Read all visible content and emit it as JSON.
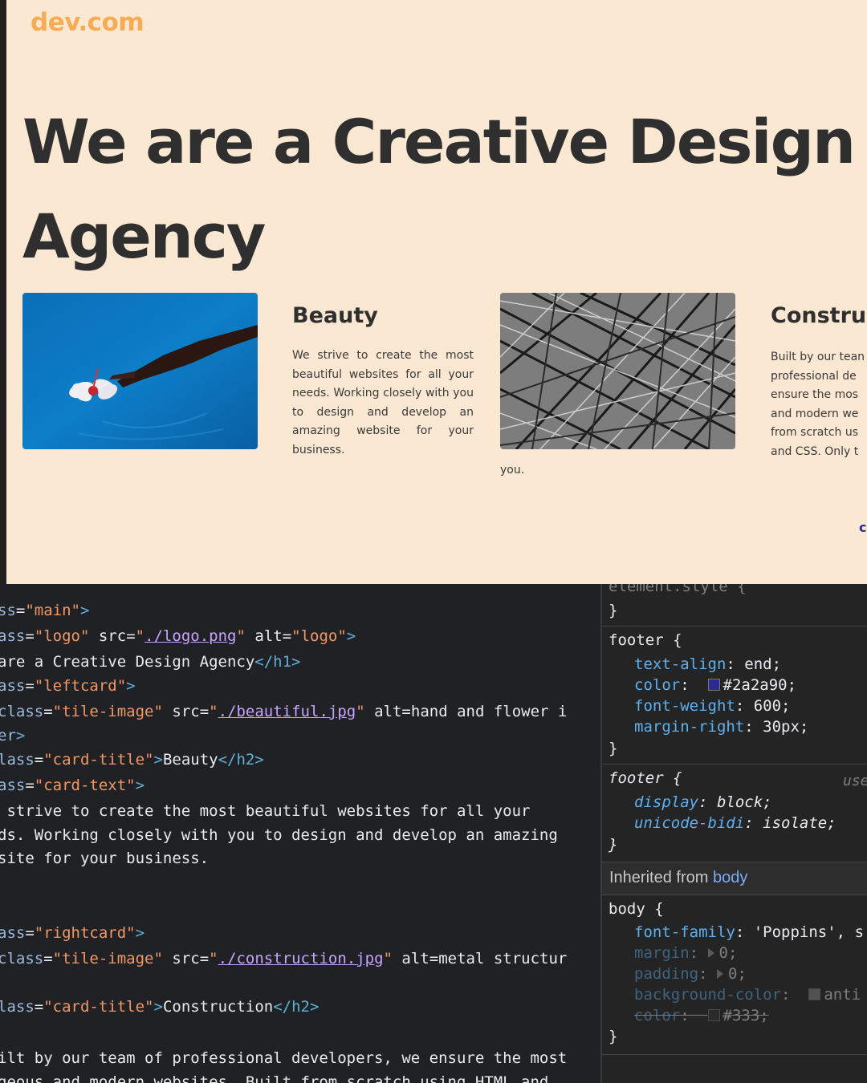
{
  "site": {
    "logo": "dev.com",
    "heading_line1": "We are a Creative Design",
    "heading_line2": "Agency",
    "cards": [
      {
        "title": "Beauty",
        "text": "We strive to create the most beautiful websites for all your needs. Working closely with you to design and develop an amazing website for your business."
      },
      {
        "title": "Constru",
        "text_lines": [
          "Built by our tean",
          "professional de",
          "ensure the mos",
          "and modern we",
          "from scratch us",
          "and CSS. Only t"
        ],
        "stray_text": "you."
      }
    ],
    "footer_fragment": "c"
  },
  "elements": {
    "lines": [
      [
        "ss=\"main\">"
      ],
      [
        "ass=\"logo\" src=\"./logo.png\" alt=\"logo\">"
      ],
      [
        "are a Creative Design Agency</h1>"
      ],
      [
        "ass=\"leftcard\">"
      ],
      [
        "class=\"tile-image\" src=\"./beautiful.jpg\" alt=\"hand and flower i"
      ],
      [
        "er\">"
      ],
      [
        "lass=\"card-title\">Beauty</h2>"
      ],
      [
        "ass=\"card-text\">"
      ],
      [
        " strive to create the most beautiful websites for all your"
      ],
      [
        "ds. Working closely with you to design and develop an amazing"
      ],
      [
        "site for your business.\""
      ],
      [
        "ass=\"rightcard\">"
      ],
      [
        "class=\"tile-image\" src=\"./construction.jpg\" alt=\"metal structur"
      ],
      [
        "lass=\"card-title\">Construction</h2>"
      ],
      [
        "ilt by our team of professional developers, we ensure the most"
      ],
      [
        "geous and modern websites. Built from scratch using HTML and"
      ]
    ]
  },
  "styles": {
    "element_style": "element.style {",
    "close_brace": "}",
    "footer_rule": {
      "selector": "footer {",
      "props": [
        {
          "name": "text-align",
          "value": "end;"
        },
        {
          "name": "color",
          "value": "#2a2a90;",
          "swatch": "#2a2a90"
        },
        {
          "name": "font-weight",
          "value": "600;"
        },
        {
          "name": "margin-right",
          "value": "30px;"
        }
      ]
    },
    "footer_ua_rule": {
      "selector": "footer {",
      "source": "use",
      "props": [
        {
          "name": "display",
          "value": "block;"
        },
        {
          "name": "unicode-bidi",
          "value": "isolate;"
        }
      ]
    },
    "inherited_label": "Inherited from",
    "inherited_link": "body",
    "body_rule": {
      "selector": "body {",
      "props": [
        {
          "name": "font-family",
          "value": "'Poppins', s"
        },
        {
          "name": "margin",
          "value": "0;"
        },
        {
          "name": "padding",
          "value": "0;"
        },
        {
          "name": "background-color",
          "value": "anti",
          "swatch": "#888888"
        },
        {
          "name": "color",
          "value": "#333;",
          "swatch": "#333333"
        }
      ]
    }
  }
}
